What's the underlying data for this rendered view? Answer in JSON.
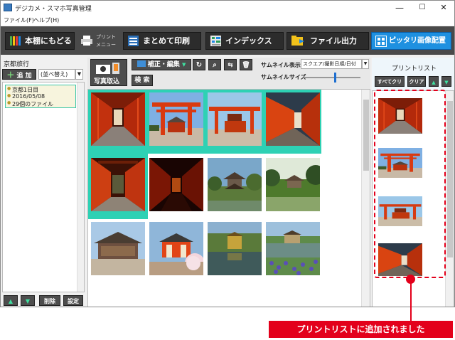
{
  "window": {
    "title": "デジカメ・スマホ写真管理",
    "minimize": "—",
    "maximize": "☐",
    "close": "✕"
  },
  "menu": {
    "file": "ファイル(F)",
    "help": "ヘルプ(H)"
  },
  "toolbar": {
    "back_label": "本棚にもどる",
    "print_menu_line1": "プリント",
    "print_menu_line2": "メニュー",
    "bulk_print_label": "まとめて印刷",
    "index_label": "インデックス",
    "file_output_label": "ファイル出力",
    "fit_layout_label": "ピッタリ画像配置"
  },
  "left": {
    "album_title": "京都旅行",
    "add_label": "追 加",
    "sort_label": "(並べ替え)",
    "album_name": "京都1日目",
    "album_date": "2016/05/08",
    "album_count": "29個のファイル",
    "delete_label": "削除",
    "settings_label": "設定"
  },
  "center": {
    "import_label": "写真取込",
    "edit_label": "補正・編集",
    "search_label": "検 索",
    "thumb_display_label": "サムネイル表示",
    "thumb_display_value": "スクエア/撮影日順/日付",
    "thumb_size_label": "サムネイルサイズ",
    "size_level": 0.55
  },
  "right": {
    "title": "プリントリスト",
    "clear_all_label": "すべてクリア",
    "clear_label": "クリア"
  },
  "callout": {
    "text": "プリントリストに追加されました"
  },
  "colors": {
    "selection": "#2ed1b4",
    "accent_blue": "#1e90e0",
    "callout_red": "#e3001b",
    "toolbar_dark": "#4a4a4a"
  }
}
